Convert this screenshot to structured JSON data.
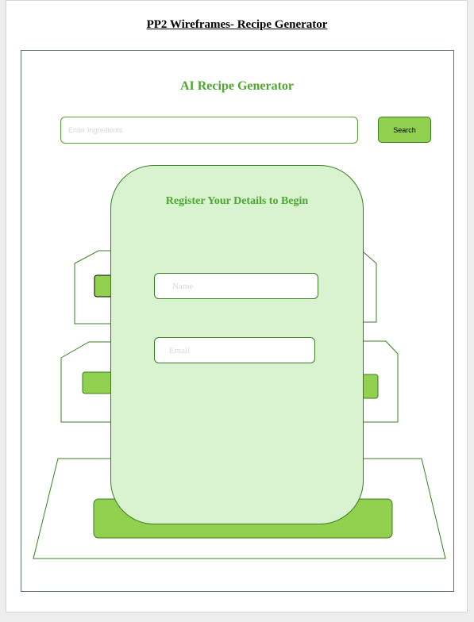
{
  "document": {
    "title": "PP2 Wireframes- Recipe Generator"
  },
  "app": {
    "title": "AI Recipe Generator",
    "search": {
      "placeholder": "Enter Ingredients",
      "value": "",
      "button_label": "Search"
    }
  },
  "modal": {
    "title": "Register Your Details to Begin",
    "name_field": {
      "placeholder": "Name",
      "value": ""
    },
    "email_field": {
      "placeholder": "Email",
      "value": ""
    }
  },
  "colors": {
    "heading_green": "#4ea72e",
    "button_green": "#92d050",
    "modal_fill": "#d9f2d0",
    "outline_green": "#3a7d22",
    "frame_border": "#5d6f7e"
  }
}
